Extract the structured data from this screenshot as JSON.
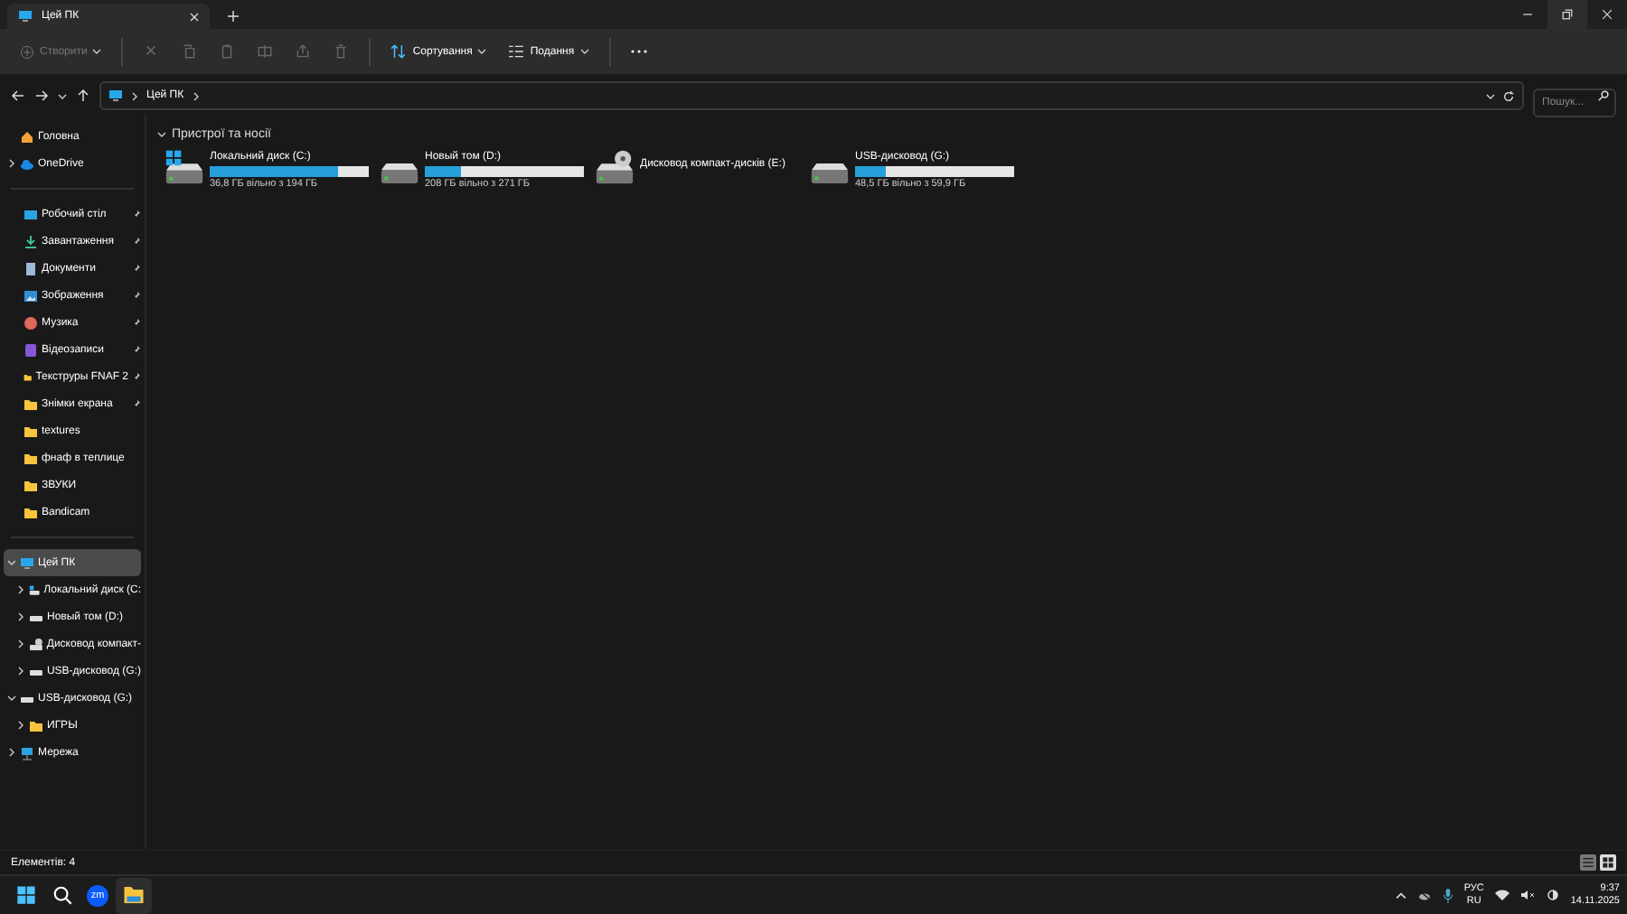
{
  "window": {
    "tab_title": "Цей ПК"
  },
  "toolbar": {
    "new": {
      "label": "Створити",
      "disabled": true
    },
    "actions": [
      {
        "kind": "cut",
        "disabled": true
      },
      {
        "kind": "copy",
        "disabled": true
      },
      {
        "kind": "paste",
        "disabled": true
      },
      {
        "kind": "rename",
        "disabled": true
      },
      {
        "kind": "share",
        "disabled": true
      },
      {
        "kind": "delete",
        "disabled": true
      }
    ],
    "sort": {
      "label": "Сортування"
    },
    "view": {
      "label": "Подання"
    }
  },
  "address": {
    "crumbs": [
      "Цей ПК"
    ],
    "search": {
      "placeholder": "Пошук..."
    }
  },
  "sidebar": {
    "top": [
      {
        "label": "Головна",
        "kind": "home"
      },
      {
        "label": "OneDrive",
        "kind": "cloud",
        "expanded": false
      }
    ],
    "quick": [
      {
        "label": "Робочий стіл",
        "kind": "desktop",
        "pinned": true
      },
      {
        "label": "Завантаження",
        "kind": "download",
        "pinned": true
      },
      {
        "label": "Документи",
        "kind": "docs",
        "pinned": true
      },
      {
        "label": "Зображення",
        "kind": "pictures",
        "pinned": true
      },
      {
        "label": "Музика",
        "kind": "music",
        "pinned": true
      },
      {
        "label": "Відеозаписи",
        "kind": "video",
        "pinned": true
      },
      {
        "label": "Текструры FNAF 2",
        "kind": "folder",
        "pinned": true
      },
      {
        "label": "Знімки екрана",
        "kind": "folder",
        "pinned": true
      },
      {
        "label": "textures",
        "kind": "folder",
        "pinned": false
      },
      {
        "label": "фнаф в теплице",
        "kind": "folder",
        "pinned": false
      },
      {
        "label": "ЗВУКИ",
        "kind": "folder",
        "pinned": false
      },
      {
        "label": "Bandicam",
        "kind": "folder",
        "pinned": false
      }
    ],
    "tree": [
      {
        "label": "Цей ПК",
        "kind": "pc",
        "expanded": true,
        "selected": true,
        "children": [
          {
            "label": "Локальний диск (C:",
            "kind": "windrive",
            "expanded": false,
            "selected": false
          },
          {
            "label": "Новый том (D:)",
            "kind": "drive",
            "expanded": false,
            "selected": false
          },
          {
            "label": "Дисковод компакт-",
            "kind": "cd",
            "expanded": false,
            "selected": false
          },
          {
            "label": "USB-дисковод (G:)",
            "kind": "drive",
            "expanded": false,
            "selected": false
          }
        ]
      },
      {
        "label": "USB-дисковод (G:)",
        "kind": "drive",
        "expanded": true,
        "selected": false,
        "children": [
          {
            "label": "ИГРЫ",
            "kind": "folder",
            "expanded": false,
            "selected": false
          }
        ]
      },
      {
        "label": "Мережа",
        "kind": "network",
        "expanded": false,
        "selected": false
      }
    ]
  },
  "content": {
    "group": {
      "title": "Пристрої та носії",
      "expanded": true
    },
    "drives": [
      {
        "name": "Локальний диск (C:)",
        "kind": "windrive",
        "level": 0.81,
        "info": "36,8 ГБ вільно з 194 ГБ"
      },
      {
        "name": "Новый том (D:)",
        "kind": "drive",
        "level": 0.23,
        "info": "208 ГБ вільно з 271 ГБ"
      },
      {
        "name": "Дисковод компакт-дисків (E:)",
        "kind": "cd"
      },
      {
        "name": "USB-дисковод (G:)",
        "kind": "drive",
        "level": 0.19,
        "info": "48,5 ГБ вільно з 59,9 ГБ"
      }
    ]
  },
  "status_bar": {
    "count": "Елементів: 4",
    "views": [
      {
        "kind": "details",
        "selected": false
      },
      {
        "kind": "tiles",
        "selected": true
      }
    ]
  },
  "taskbar": {
    "apps": [
      {
        "kind": "start",
        "active": false
      },
      {
        "kind": "search",
        "active": false
      },
      {
        "kind": "zoom",
        "label": "zm",
        "active": false
      },
      {
        "kind": "explorer",
        "active": true
      }
    ],
    "language": {
      "top": "РУС",
      "bottom": "RU"
    },
    "time": "9:37",
    "date": "14.11.2025"
  }
}
